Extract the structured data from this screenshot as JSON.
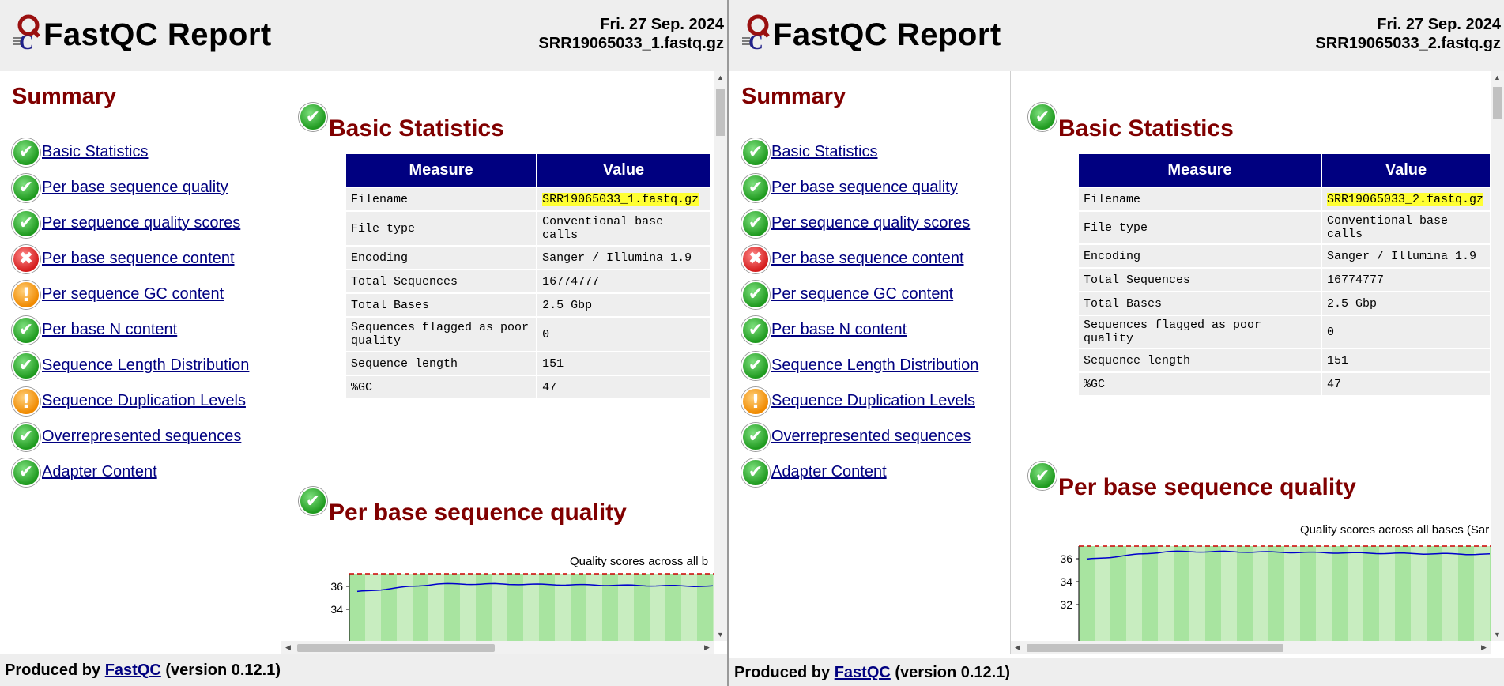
{
  "report_title": "FastQC Report",
  "panels": [
    {
      "date": "Fri. 27 Sep. 2024",
      "filename": "SRR19065033_1.fastq.gz",
      "summary_heading": "Summary",
      "summary_items": [
        {
          "label": "Basic Statistics",
          "status": "pass"
        },
        {
          "label": "Per base sequence quality",
          "status": "pass"
        },
        {
          "label": "Per sequence quality scores",
          "status": "pass"
        },
        {
          "label": "Per base sequence content",
          "status": "fail"
        },
        {
          "label": "Per sequence GC content",
          "status": "warn"
        },
        {
          "label": "Per base N content",
          "status": "pass"
        },
        {
          "label": "Sequence Length Distribution",
          "status": "pass"
        },
        {
          "label": "Sequence Duplication Levels",
          "status": "warn"
        },
        {
          "label": "Overrepresented sequences",
          "status": "pass"
        },
        {
          "label": "Adapter Content",
          "status": "pass"
        }
      ],
      "basic_stats_heading": "Basic Statistics",
      "table_headers": [
        "Measure",
        "Value"
      ],
      "table_rows": [
        [
          "Filename",
          "SRR19065033_1.fastq.gz"
        ],
        [
          "File type",
          "Conventional base calls"
        ],
        [
          "Encoding",
          "Sanger / Illumina 1.9"
        ],
        [
          "Total Sequences",
          "16774777"
        ],
        [
          "Total Bases",
          "2.5 Gbp"
        ],
        [
          "Sequences flagged as poor quality",
          "0"
        ],
        [
          "Sequence length",
          "151"
        ],
        [
          "%GC",
          "47"
        ]
      ],
      "quality_heading": "Per base sequence quality",
      "chart_title": "Quality scores across all b",
      "chart_ticks": [
        "36",
        "34"
      ],
      "footer_prefix": "Produced by ",
      "footer_link": "FastQC",
      "footer_suffix": " (version 0.12.1)"
    },
    {
      "date": "Fri. 27 Sep. 2024",
      "filename": "SRR19065033_2.fastq.gz",
      "summary_heading": "Summary",
      "summary_items": [
        {
          "label": "Basic Statistics",
          "status": "pass"
        },
        {
          "label": "Per base sequence quality",
          "status": "pass"
        },
        {
          "label": "Per sequence quality scores",
          "status": "pass"
        },
        {
          "label": "Per base sequence content",
          "status": "fail"
        },
        {
          "label": "Per sequence GC content",
          "status": "pass"
        },
        {
          "label": "Per base N content",
          "status": "pass"
        },
        {
          "label": "Sequence Length Distribution",
          "status": "pass"
        },
        {
          "label": "Sequence Duplication Levels",
          "status": "warn"
        },
        {
          "label": "Overrepresented sequences",
          "status": "pass"
        },
        {
          "label": "Adapter Content",
          "status": "pass"
        }
      ],
      "basic_stats_heading": "Basic Statistics",
      "table_headers": [
        "Measure",
        "Value"
      ],
      "table_rows": [
        [
          "Filename",
          "SRR19065033_2.fastq.gz"
        ],
        [
          "File type",
          "Conventional base calls"
        ],
        [
          "Encoding",
          "Sanger / Illumina 1.9"
        ],
        [
          "Total Sequences",
          "16774777"
        ],
        [
          "Total Bases",
          "2.5 Gbp"
        ],
        [
          "Sequences flagged as poor quality",
          "0"
        ],
        [
          "Sequence length",
          "151"
        ],
        [
          "%GC",
          "47"
        ]
      ],
      "quality_heading": "Per base sequence quality",
      "chart_title": "Quality scores across all bases (Sar",
      "chart_ticks": [
        "36",
        "34",
        "32"
      ],
      "footer_prefix": "Produced by ",
      "footer_link": "FastQC",
      "footer_suffix": " (version 0.12.1)"
    }
  ],
  "icons": {
    "pass": "check-icon",
    "fail": "cross-icon",
    "warn": "exclamation-icon"
  },
  "colors": {
    "heading": "#800000",
    "table_header": "#000080",
    "link": "#000080",
    "highlight": "#ffff33",
    "chart_green": "#a8e4a0",
    "chart_line": "#0000cc",
    "threshold": "#cc0000"
  }
}
